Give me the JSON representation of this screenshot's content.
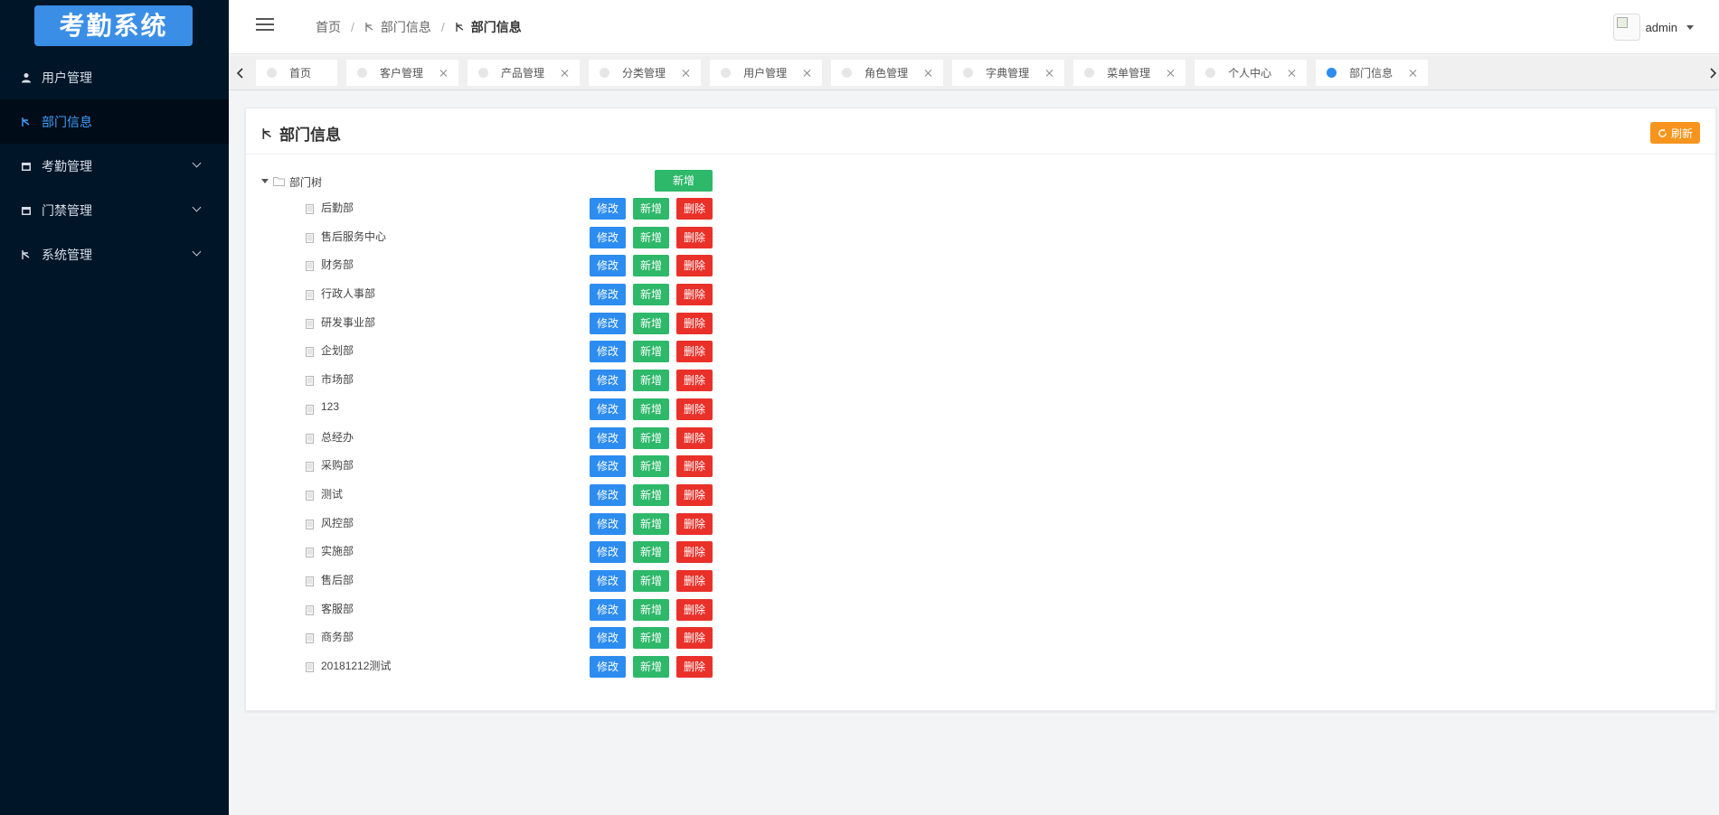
{
  "sidebar": {
    "logo": "考勤系统",
    "items": [
      {
        "label": "用户管理",
        "icon": "user-icon",
        "expandable": false,
        "active": false
      },
      {
        "label": "部门信息",
        "icon": "sitemap-icon",
        "expandable": false,
        "active": true
      },
      {
        "label": "考勤管理",
        "icon": "calendar-icon",
        "expandable": true,
        "active": false
      },
      {
        "label": "门禁管理",
        "icon": "door-icon",
        "expandable": true,
        "active": false
      },
      {
        "label": "系统管理",
        "icon": "sitemap-icon",
        "expandable": true,
        "active": false
      }
    ]
  },
  "header": {
    "breadcrumb": {
      "home": "首页",
      "parent": "部门信息",
      "current": "部门信息"
    },
    "user": "admin"
  },
  "tabs": [
    {
      "label": "首页",
      "closable": false,
      "active": false
    },
    {
      "label": "客户管理",
      "closable": true,
      "active": false
    },
    {
      "label": "产品管理",
      "closable": true,
      "active": false
    },
    {
      "label": "分类管理",
      "closable": true,
      "active": false
    },
    {
      "label": "用户管理",
      "closable": true,
      "active": false
    },
    {
      "label": "角色管理",
      "closable": true,
      "active": false
    },
    {
      "label": "字典管理",
      "closable": true,
      "active": false
    },
    {
      "label": "菜单管理",
      "closable": true,
      "active": false
    },
    {
      "label": "个人中心",
      "closable": true,
      "active": false
    },
    {
      "label": "部门信息",
      "closable": true,
      "active": true
    }
  ],
  "panel": {
    "title": "部门信息",
    "refresh_label": "刷新"
  },
  "tree": {
    "root_label": "部门树",
    "root_add_label": "新增",
    "edit_label": "修改",
    "add_label": "新增",
    "delete_label": "删除",
    "nodes": [
      "后勤部",
      "售后服务中心",
      "财务部",
      "行政人事部",
      "研发事业部",
      "企划部",
      "市场部",
      "123",
      "总经办",
      "采购部",
      "测试",
      "风控部",
      "实施部",
      "售后部",
      "客服部",
      "商务部",
      "20181212测试"
    ]
  },
  "colors": {
    "sidebar_bg": "#001528",
    "accent": "#409eff",
    "edit": "#2d8cf0",
    "add": "#2eb86a",
    "delete": "#e9312a",
    "refresh": "#f7941d"
  }
}
